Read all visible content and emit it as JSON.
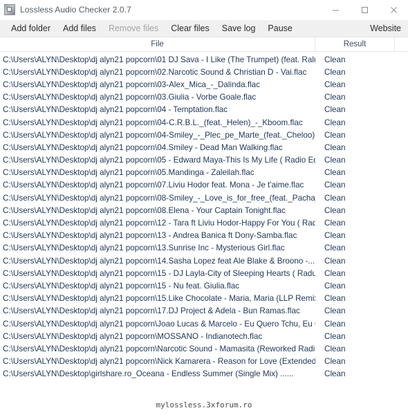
{
  "window": {
    "title": "Lossless Audio Checker 2.0.7",
    "icon": "app-icon",
    "controls": {
      "minimize": "minimize-icon",
      "maximize": "maximize-icon",
      "close": "close-icon"
    }
  },
  "menubar": {
    "items": [
      {
        "label": "Add folder",
        "disabled": false
      },
      {
        "label": "Add files",
        "disabled": false
      },
      {
        "label": "Remove files",
        "disabled": true
      },
      {
        "label": "Clear files",
        "disabled": false
      },
      {
        "label": "Save log",
        "disabled": false
      },
      {
        "label": "Pause",
        "disabled": false
      }
    ],
    "website_label": "Website"
  },
  "table": {
    "headers": {
      "file": "File",
      "result": "Result"
    },
    "rows": [
      {
        "file": "C:\\Users\\ALYN\\Desktop\\dj alyn21 popcorn\\01 DJ Sava - I Like (The Trumpet) (feat. Raluka).flac",
        "result": "Clean"
      },
      {
        "file": "C:\\Users\\ALYN\\Desktop\\dj alyn21 popcorn\\02.Narcotic Sound & Christian D - Vai.flac",
        "result": "Clean"
      },
      {
        "file": "C:\\Users\\ALYN\\Desktop\\dj alyn21 popcorn\\03-Alex_Mica_-_Dalinda.flac",
        "result": "Clean"
      },
      {
        "file": "C:\\Users\\ALYN\\Desktop\\dj alyn21 popcorn\\03.Giulia - Vorbe Goale.flac",
        "result": "Clean"
      },
      {
        "file": "C:\\Users\\ALYN\\Desktop\\dj alyn21 popcorn\\04 - Temptation.flac",
        "result": "Clean"
      },
      {
        "file": "C:\\Users\\ALYN\\Desktop\\dj alyn21 popcorn\\04-C.R.B.L._(feat._Helen)_-_Kboom.flac",
        "result": "Clean"
      },
      {
        "file": "C:\\Users\\ALYN\\Desktop\\dj alyn21 popcorn\\04-Smiley_-_Plec_pe_Marte_(feat._Cheloo).flac",
        "result": "Clean"
      },
      {
        "file": "C:\\Users\\ALYN\\Desktop\\dj alyn21 popcorn\\04.Smiley - Dead Man Walking.flac",
        "result": "Clean"
      },
      {
        "file": "C:\\Users\\ALYN\\Desktop\\dj alyn21 popcorn\\05 - Edward Maya-This Is My Life ( Radio Edit ).flac",
        "result": "Clean"
      },
      {
        "file": "C:\\Users\\ALYN\\Desktop\\dj alyn21 popcorn\\05.Mandinga - Zaleilah.flac",
        "result": "Clean"
      },
      {
        "file": "C:\\Users\\ALYN\\Desktop\\dj alyn21 popcorn\\07.Liviu Hodor feat. Mona - Je t'aime.flac",
        "result": "Clean"
      },
      {
        "file": "C:\\Users\\ALYN\\Desktop\\dj alyn21 popcorn\\08-Smiley_-_Love_is_for_free_(feat._Pacha_Man).flac",
        "result": "Clean"
      },
      {
        "file": "C:\\Users\\ALYN\\Desktop\\dj alyn21 popcorn\\08.Elena - Your Captain Tonight.flac",
        "result": "Clean"
      },
      {
        "file": "C:\\Users\\ALYN\\Desktop\\dj alyn21 popcorn\\12 - Tara ft Liviu Hodor-Happy For You ( Radio...",
        "result": "Clean"
      },
      {
        "file": "C:\\Users\\ALYN\\Desktop\\dj alyn21 popcorn\\13 - Andrea Banica ft Dony-Samba.flac",
        "result": "Clean"
      },
      {
        "file": "C:\\Users\\ALYN\\Desktop\\dj alyn21 popcorn\\13.Sunrise Inc - Mysterious Girl.flac",
        "result": "Clean"
      },
      {
        "file": "C:\\Users\\ALYN\\Desktop\\dj alyn21 popcorn\\14.Sasha Lopez feat Ale Blake & Broono -...",
        "result": "Clean"
      },
      {
        "file": "C:\\Users\\ALYN\\Desktop\\dj alyn21 popcorn\\15 - DJ Layla-City of Sleeping Hearts ( Radu...",
        "result": "Clean"
      },
      {
        "file": "C:\\Users\\ALYN\\Desktop\\dj alyn21 popcorn\\15 - Nu feat. Giulia.flac",
        "result": "Clean"
      },
      {
        "file": "C:\\Users\\ALYN\\Desktop\\dj alyn21 popcorn\\15.Like Chocolate - Maria, Maria (LLP Remix).flac",
        "result": "Clean"
      },
      {
        "file": "C:\\Users\\ALYN\\Desktop\\dj alyn21 popcorn\\17.DJ Project & Adela - Bun Ramas.flac",
        "result": "Clean"
      },
      {
        "file": "C:\\Users\\ALYN\\Desktop\\dj alyn21 popcorn\\Joao Lucas & Marcelo - Eu Quero Tchu, Eu Quero...",
        "result": "Clean"
      },
      {
        "file": "C:\\Users\\ALYN\\Desktop\\dj alyn21 popcorn\\MOSSANO - Indianotech.flac",
        "result": "Clean"
      },
      {
        "file": "C:\\Users\\ALYN\\Desktop\\dj alyn21 popcorn\\Narcotic Sound - Mamasita (Reworked Radio...",
        "result": "Clean"
      },
      {
        "file": "C:\\Users\\ALYN\\Desktop\\dj alyn21 popcorn\\Nick Kamarera - Reason for Love (Extended).flac",
        "result": "Clean"
      },
      {
        "file": "C:\\Users\\ALYN\\Desktop\\girlshare.ro_Oceana - Endless Summer (Single Mix) ......",
        "result": "Clean"
      }
    ]
  },
  "footer": {
    "watermark": "mylossless.3xforum.ro"
  },
  "colors": {
    "menubar_bg": "#f0f0f0",
    "row_text": "#23395b",
    "disabled_text": "#a6a6a6"
  }
}
